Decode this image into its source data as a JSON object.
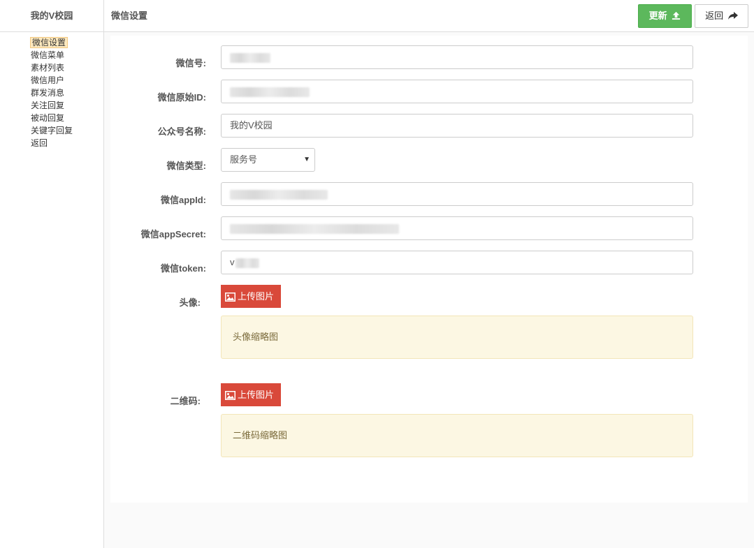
{
  "sidebar": {
    "title": "我的V校园",
    "items": [
      {
        "label": "微信设置",
        "active": true
      },
      {
        "label": "微信菜单"
      },
      {
        "label": "素材列表"
      },
      {
        "label": "微信用户"
      },
      {
        "label": "群发消息"
      },
      {
        "label": "关注回复"
      },
      {
        "label": "被动回复"
      },
      {
        "label": "关键字回复"
      },
      {
        "label": "返回"
      }
    ]
  },
  "header": {
    "title": "微信设置",
    "update_label": "更新",
    "back_label": "返回"
  },
  "form": {
    "wechat_id_label": "微信号:",
    "original_id_label": "微信原始ID:",
    "account_name_label": "公众号名称:",
    "account_name_value": "我的V校园",
    "type_label": "微信类型:",
    "type_value": "服务号",
    "appid_label": "微信appId:",
    "appsecret_label": "微信appSecret:",
    "token_label": "微信token:",
    "token_prefix": "v",
    "avatar_label": "头像:",
    "avatar_upload_label": "上传图片",
    "avatar_thumb_text": "头像缩略图",
    "qrcode_label": "二维码:",
    "qrcode_upload_label": "上传图片",
    "qrcode_thumb_text": "二维码缩略图"
  },
  "colors": {
    "update_button": "#5cb85c",
    "upload_button": "#d9493a",
    "thumb_background": "#fcf7e3",
    "active_item_background": "#fde9bf"
  }
}
